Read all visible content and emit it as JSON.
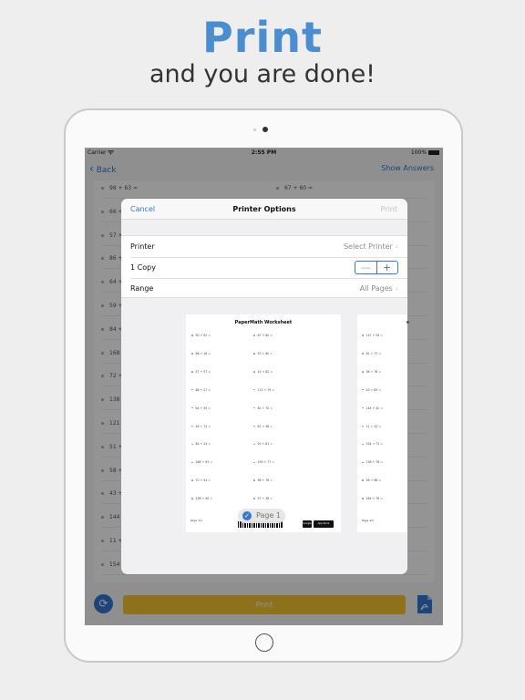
{
  "marketing": {
    "headline": "Print",
    "subline": "and you are done!"
  },
  "status_bar": {
    "carrier": "Carrier",
    "wifi_icon": "wifi-icon",
    "time": "2:55 PM",
    "battery": "100%"
  },
  "nav": {
    "back_label": "Back",
    "show_answers_label": "Show Answers"
  },
  "worksheet_rows": [
    {
      "left": "98 + 63 =",
      "right": "67 + 60 ="
    },
    {
      "left": "66 + 16 =",
      "right": ""
    },
    {
      "left": "57 + 57 =",
      "right": ""
    },
    {
      "left": "86 + 27 =",
      "right": ""
    },
    {
      "left": "64 + 35 =",
      "right": ""
    },
    {
      "left": "59 + 73 =",
      "right": ""
    },
    {
      "left": "84 + 24 =",
      "right": ""
    },
    {
      "left": "168 + 93 =",
      "right": ""
    },
    {
      "left": "72 + 54 =",
      "right": ""
    },
    {
      "left": "138 + 90 =",
      "right": ""
    },
    {
      "left": "121 + 59 =",
      "right": ""
    },
    {
      "left": "51 + 77 =",
      "right": ""
    },
    {
      "left": "58 + 78 =",
      "right": ""
    },
    {
      "left": "43 + 83 =",
      "right": ""
    },
    {
      "left": "144 + 42 =",
      "right": ""
    },
    {
      "left": "11 + 43 =",
      "right": ""
    },
    {
      "left": "154 + 73 =",
      "right": ""
    }
  ],
  "bottom_bar": {
    "print_label": "Print"
  },
  "printer_options": {
    "cancel_label": "Cancel",
    "title": "Printer Options",
    "print_label": "Print",
    "rows": {
      "printer": {
        "label": "Printer",
        "value": "Select Printer"
      },
      "copies": {
        "label": "1 Copy",
        "minus": "—",
        "plus": "+"
      },
      "range": {
        "label": "Range",
        "value": "All Pages"
      }
    },
    "page_indicator": "Page 1"
  },
  "preview_page1": {
    "title": "PaperMath Worksheet",
    "left_column": [
      "90 + 92 =",
      "66 + 16 =",
      "57 + 57 =",
      "86 + 27 =",
      "64 + 35 =",
      "59 + 73 =",
      "84 + 24 =",
      "168 + 93 =",
      "72 + 54 =",
      "138 + 90 ="
    ],
    "right_column": [
      "67 + 60 =",
      "53 + 60 =",
      "15 + 82 =",
      "113 + 79 =",
      "82 + 70 =",
      "87 + 48 =",
      "20 + 81 =",
      "159 + 77 =",
      "98 + 76 =",
      "57 + 38 ="
    ],
    "footer_page": "Page 1/2",
    "badge_1": "Google Play",
    "badge_2": "App Store"
  },
  "preview_page2": {
    "items": [
      "121 + 59 =",
      "81 + 77 =",
      "58 + 78 =",
      "43 + 83 =",
      "144 + 42 =",
      "11 + 43 =",
      "154 + 73 =",
      "138 + 78 =",
      "28 + 98 =",
      "164 + 78 ="
    ],
    "footer_page": "Page 2/2"
  }
}
